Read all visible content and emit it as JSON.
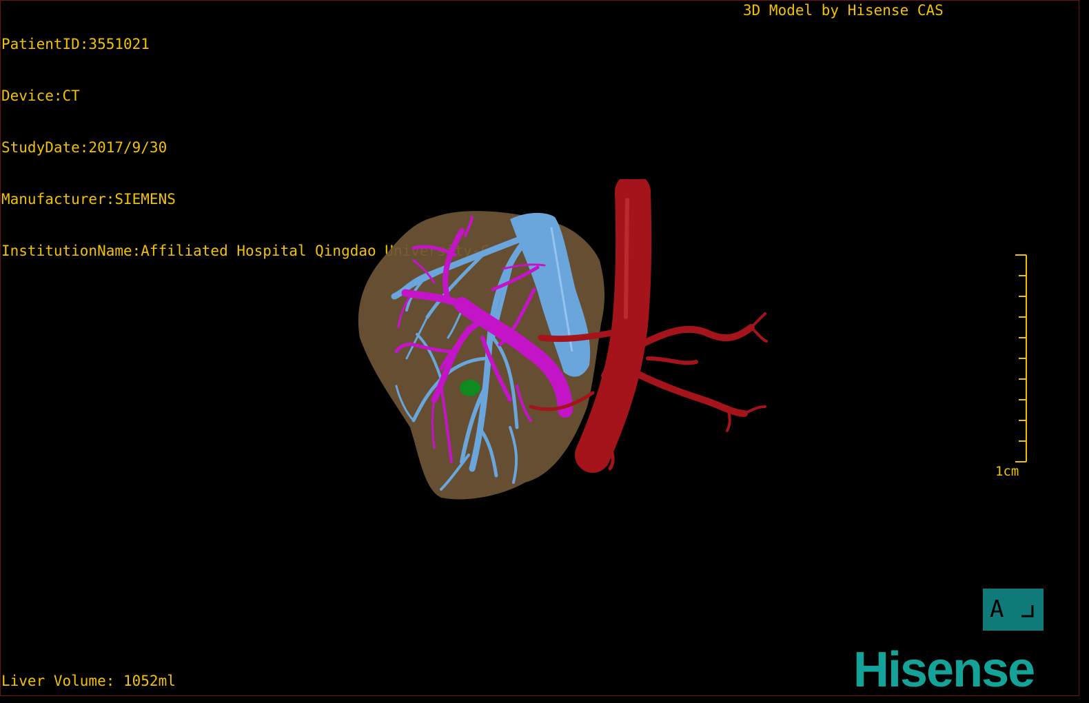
{
  "overlay": {
    "patient_id": "PatientID:3551021",
    "device": "Device:CT",
    "study_date": "StudyDate:2017/9/30",
    "manufacturer": "Manufacturer:SIEMENS",
    "institution": "InstitutionName:Affiliated Hospital Qingdao University-C",
    "credit": "3D Model by Hisense CAS",
    "liver_volume": "Liver Volume: 1052ml"
  },
  "scale": {
    "label": "1cm"
  },
  "orientation": {
    "letter": "A"
  },
  "logo": {
    "text": "Hisense"
  },
  "colors": {
    "overlay_text": "#f2c200",
    "liver": "#6e5536",
    "hepatic_vein": "#6aa6dc",
    "portal_vein": "#c414c8",
    "artery": "#a4141a",
    "lesion": "#0f8a1e",
    "brand": "#13a398"
  }
}
